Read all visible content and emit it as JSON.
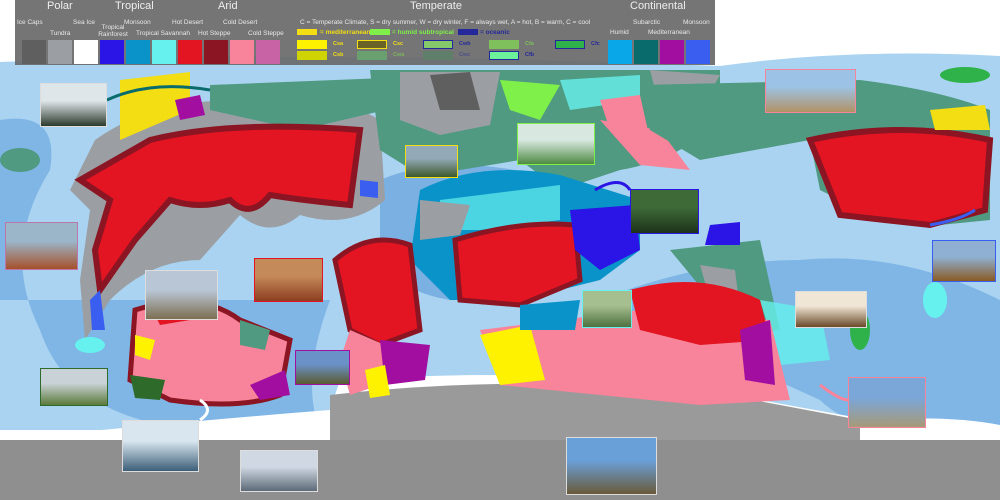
{
  "legend": {
    "groups": {
      "polar": "Polar",
      "tropical": "Tropical",
      "arid": "Arid",
      "temperate": "Temperate",
      "continental": "Continental"
    },
    "polar": [
      {
        "label": "Ice Caps",
        "color": "#5f5f5f"
      },
      {
        "label": "Tundra",
        "color": "#9b9ea3"
      },
      {
        "label": "Sea Ice",
        "color": "#ffffff"
      }
    ],
    "tropical": [
      {
        "label": "Tropical Rainforest",
        "color": "#2a14e6"
      },
      {
        "label": "Monsoon",
        "color": "#0a93c8"
      },
      {
        "label": "Tropical Savannah",
        "color": "#66f1ee"
      }
    ],
    "arid": [
      {
        "label": "Hot Desert",
        "color": "#e31522"
      },
      {
        "label": "Hot Steppe",
        "color": "#8b1523"
      },
      {
        "label": "Cold Desert",
        "color": "#f7849a"
      },
      {
        "label": "Cold Steppe",
        "color": "#c863a6"
      }
    ],
    "temperate": {
      "explanation": "C = Temperate Climate, S = dry summer, W = dry winter, F = always wet, A = hot, B = warm, C = cool",
      "key": [
        {
          "label": "= mediterranean",
          "color": "#f2de13"
        },
        {
          "label": "= humid subtropical",
          "color": "#7ff04a"
        },
        {
          "label": "= oceanic",
          "color": "#25289a"
        }
      ],
      "codes": [
        {
          "code": "Csa",
          "color": "#fff200",
          "text": "#f2de13"
        },
        {
          "code": "Csb",
          "color": "#cfd400",
          "text": "#f2de13"
        },
        {
          "code": "Csc",
          "color": "#6b6228",
          "text": "#f2de13"
        },
        {
          "code": "Cwa",
          "color": "#6aa070",
          "text": "#7ff04a"
        },
        {
          "code": "Cwb",
          "color": "#86c96b",
          "text": "#25289a"
        },
        {
          "code": "Cwc",
          "color": "#5f7f6a",
          "text": "#25289a"
        },
        {
          "code": "Cfa",
          "color": "#7fbf5c",
          "text": "#7ff04a"
        },
        {
          "code": "Cfb",
          "color": "#6cf29a",
          "text": "#25289a"
        },
        {
          "code": "Cfc",
          "color": "#2fb24a",
          "text": "#25289a"
        }
      ]
    },
    "continental": [
      {
        "label": "Humid",
        "color": "#0aa7e8"
      },
      {
        "label": "Subarctic",
        "color": "#0a6b6d"
      },
      {
        "label": "Mediterranean",
        "color": "#a10ea0"
      },
      {
        "label": "Monsoon",
        "color": "#3a5ef0"
      }
    ]
  },
  "colors": {
    "ocean_shallow": "#a9d3f0",
    "ocean_mid": "#7fb6e6",
    "ocean_deep": "#5b9ad8",
    "antarctic": "#9a9a9a",
    "ice": "#ffffff"
  },
  "photos": [
    {
      "subject": "snowy-forest",
      "c1": "#dfe6ea",
      "c2": "#2b3a2c"
    },
    {
      "subject": "autumn-hills",
      "c1": "#9bb5c9",
      "c2": "#a5502a"
    },
    {
      "subject": "desert-mountains",
      "c1": "#b9c6d6",
      "c2": "#7d6e52"
    },
    {
      "subject": "red-desert",
      "c1": "#c58a5a",
      "c2": "#8d3e20"
    },
    {
      "subject": "steppe-tree",
      "c1": "#6a92c8",
      "c2": "#5a5a30"
    },
    {
      "subject": "misty-grassland",
      "c1": "#c9d2d6",
      "c2": "#5b7a3a"
    },
    {
      "subject": "sea-ice",
      "c1": "#d9e6ef",
      "c2": "#3c5f79"
    },
    {
      "subject": "snowy-peaks",
      "c1": "#cfd8e3",
      "c2": "#5e6a78"
    },
    {
      "subject": "pine-lake",
      "c1": "#94a9b8",
      "c2": "#3d5a2c"
    },
    {
      "subject": "karst-lake",
      "c1": "#d8e8e0",
      "c2": "#4f8a44"
    },
    {
      "subject": "rainforest",
      "c1": "#3e6a38",
      "c2": "#1c321a"
    },
    {
      "subject": "tall-grass",
      "c1": "#a6bf90",
      "c2": "#4f7040"
    },
    {
      "subject": "arid-valley",
      "c1": "#9cc3e6",
      "c2": "#b29266"
    },
    {
      "subject": "autumn-forest",
      "c1": "#8fb0d2",
      "c2": "#8a5a24"
    },
    {
      "subject": "baobabs",
      "c1": "#f0e6d6",
      "c2": "#6b4a2a"
    },
    {
      "subject": "volcano-plain",
      "c1": "#7aa6d8",
      "c2": "#a79a78"
    },
    {
      "subject": "alpine-meadow",
      "c1": "#6aa0d8",
      "c2": "#6a5a3a"
    }
  ]
}
